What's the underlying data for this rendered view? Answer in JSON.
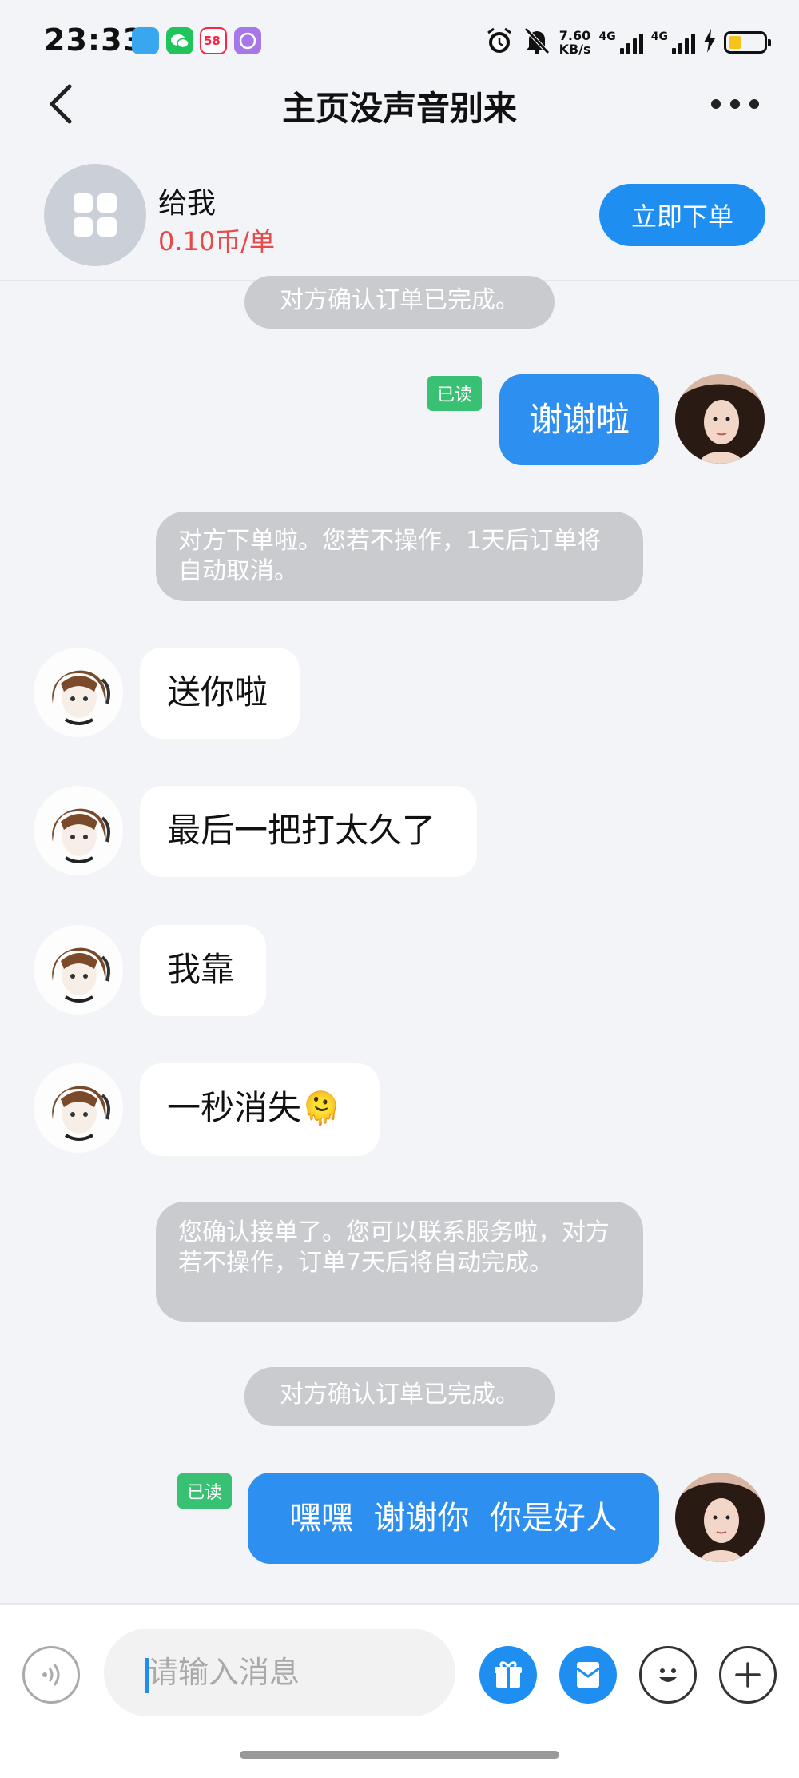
{
  "status_bar": {
    "time": "23:33",
    "net_speed_value": "7.60",
    "net_speed_unit": "KB/s",
    "sim1": "4G",
    "sim2": "4G",
    "apps": [
      "assistant-app-icon",
      "wechat-icon",
      "58-app-icon",
      "purple-app-icon"
    ],
    "icons": [
      "alarm-icon",
      "mute-icon",
      "battery-icon"
    ]
  },
  "header": {
    "title": "主页没声音别来"
  },
  "service": {
    "name": "给我",
    "price": "0.10币/单",
    "order_button": "立即下单"
  },
  "messages": {
    "m0": "对方确认订单已完成。",
    "m1_text": "谢谢啦",
    "m1_read": "已读",
    "m2": "对方下单啦。您若不操作，1天后订单将自动取消。",
    "m3": "送你啦",
    "m4": "最后一把打太久了",
    "m5": "我靠",
    "m6_text": "一秒消失",
    "m6_emoji": "🫠",
    "m7": "您确认接单了。您可以联系服务啦，对方若不操作，订单7天后将自动完成。",
    "m8": "对方确认订单已完成。",
    "m9_text": "嘿嘿  谢谢你  你是好人",
    "m9_read": "已读"
  },
  "input": {
    "placeholder": "请输入消息"
  },
  "colors": {
    "accent": "#1e8ff0",
    "price": "#e84a4a",
    "read_badge": "#38c173",
    "system_pill": "#c9cbcf"
  }
}
